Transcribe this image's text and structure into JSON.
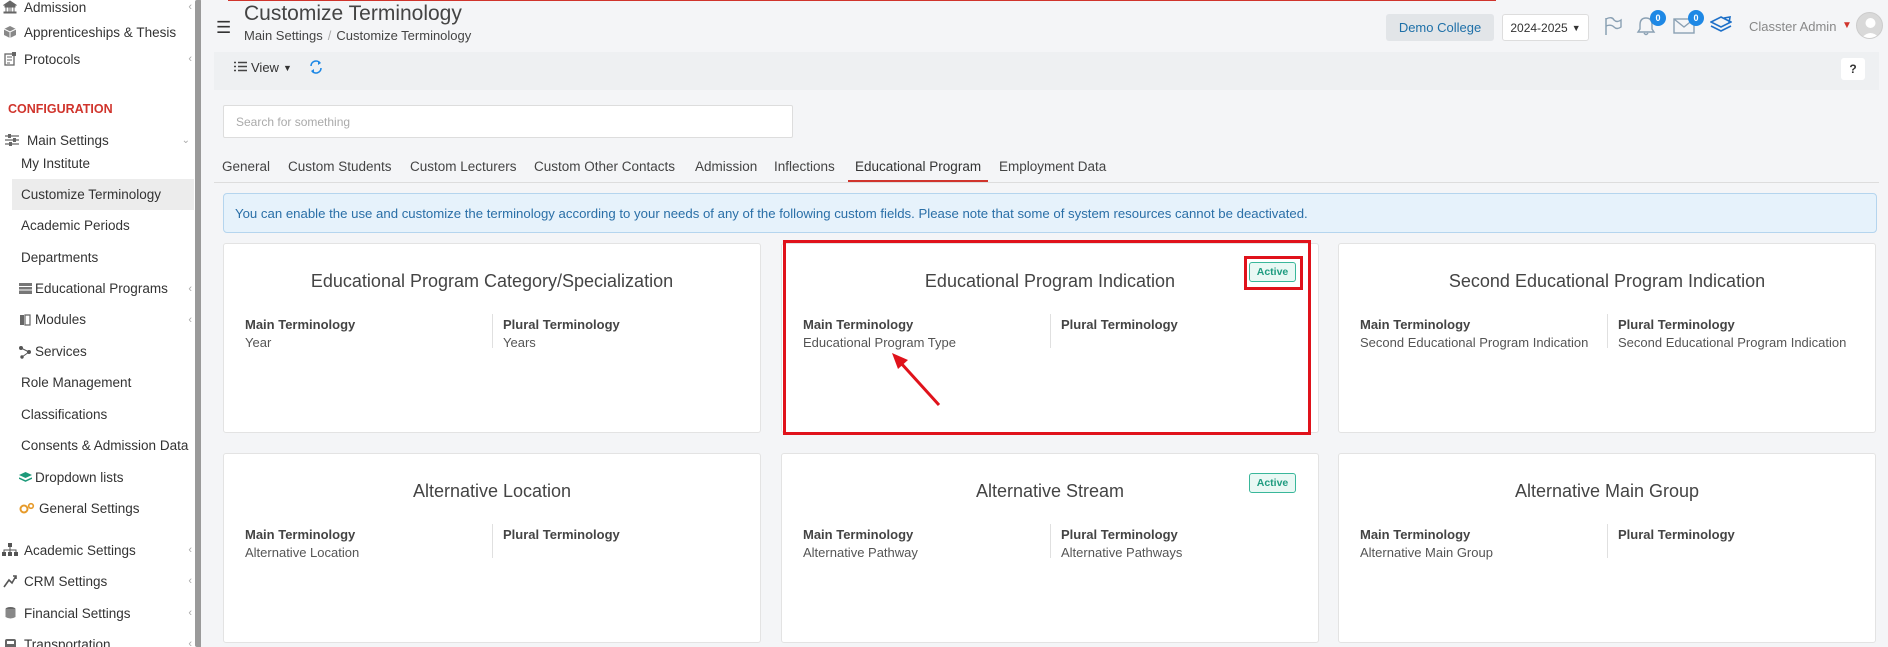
{
  "sidebar": {
    "items_top": [
      {
        "label": "Admission",
        "icon": "institution-icon"
      },
      {
        "label": "Apprenticeships & Thesis",
        "icon": "cube-icon"
      },
      {
        "label": "Protocols",
        "icon": "protocol-icon"
      }
    ],
    "section": "CONFIGURATION",
    "main_settings": "Main Settings",
    "sub_items": [
      {
        "label": "My Institute"
      },
      {
        "label": "Customize Terminology",
        "active": true
      },
      {
        "label": "Academic Periods"
      },
      {
        "label": "Departments"
      },
      {
        "label": "Educational Programs",
        "icon": "table-icon"
      },
      {
        "label": "Modules",
        "icon": "book-icon"
      },
      {
        "label": "Services",
        "icon": "nodes-icon"
      },
      {
        "label": "Role Management"
      },
      {
        "label": "Classifications"
      },
      {
        "label": "Consents & Admission Data"
      },
      {
        "label": "Dropdown lists",
        "icon": "layers-icon"
      },
      {
        "label": "General Settings",
        "icon": "cogs-icon"
      }
    ],
    "items_bottom": [
      {
        "label": "Academic Settings",
        "icon": "sitemap-icon"
      },
      {
        "label": "CRM Settings",
        "icon": "crm-icon"
      },
      {
        "label": "Financial Settings",
        "icon": "coins-icon"
      },
      {
        "label": "Transportation",
        "icon": "bus-icon"
      }
    ]
  },
  "header": {
    "title": "Customize Terminology",
    "breadcrumb": [
      "Main Settings",
      "Customize Terminology"
    ],
    "college": "Demo College",
    "year": "2024-2025",
    "notifications_count": "0",
    "messages_count": "0",
    "user": "Classter Admin"
  },
  "toolbar": {
    "view_label": "View",
    "help_label": "?"
  },
  "search": {
    "placeholder": "Search for something"
  },
  "tabs": [
    {
      "label": "General"
    },
    {
      "label": "Custom Students"
    },
    {
      "label": "Custom Lecturers"
    },
    {
      "label": "Custom Other Contacts"
    },
    {
      "label": "Admission"
    },
    {
      "label": "Inflections"
    },
    {
      "label": "Educational Program",
      "active": true
    },
    {
      "label": "Employment Data"
    }
  ],
  "info_text": "You can enable the use and customize the terminology according to your needs of any of the following custom fields. Please note that some of system resources cannot be deactivated.",
  "labels": {
    "main": "Main Terminology",
    "plural": "Plural Terminology",
    "active": "Active"
  },
  "cards": [
    {
      "title": "Educational Program Category/Specialization",
      "main": "Year",
      "plural": "Years",
      "active": false
    },
    {
      "title": "Educational Program Indication",
      "main": "Educational Program Type",
      "plural": "",
      "active": true
    },
    {
      "title": "Second Educational Program Indication",
      "main": "Second Educational Program Indication",
      "plural": "Second Educational Program Indication",
      "active": false
    },
    {
      "title": "Alternative Location",
      "main": "Alternative Location",
      "plural": "",
      "active": false
    },
    {
      "title": "Alternative Stream",
      "main": "Alternative Pathway",
      "plural": "Alternative Pathways",
      "active": true
    },
    {
      "title": "Alternative Main Group",
      "main": "Alternative Main Group",
      "plural": "",
      "active": false
    }
  ],
  "colors": {
    "accent": "#d0342c",
    "link": "#1e70a8",
    "highlight": "#e0121b",
    "active_green": "#1f9c80"
  }
}
